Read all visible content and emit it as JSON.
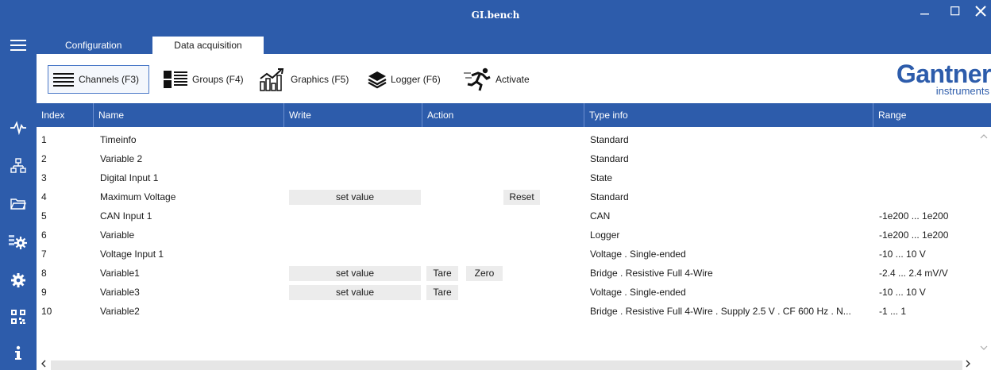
{
  "window": {
    "title": "GI.bench"
  },
  "tabs": [
    {
      "label": "Configuration"
    },
    {
      "label": "Data acquisition"
    }
  ],
  "toolbar": {
    "channels": "Channels (F3)",
    "groups": "Groups (F4)",
    "graphics": "Graphics (F5)",
    "logger": "Logger (F6)",
    "activate": "Activate"
  },
  "logo": {
    "brand": "Gantner",
    "sub": "instruments"
  },
  "table": {
    "headers": [
      "Index",
      "Name",
      "Write",
      "Action",
      "Type info",
      "Range"
    ],
    "rows": [
      {
        "index": "1",
        "name": "Timeinfo",
        "write": "",
        "tare": "",
        "zero": "",
        "reset": "",
        "type": "Standard",
        "range": ""
      },
      {
        "index": "2",
        "name": "Variable 2",
        "write": "",
        "tare": "",
        "zero": "",
        "reset": "",
        "type": "Standard",
        "range": ""
      },
      {
        "index": "3",
        "name": "Digital Input 1",
        "write": "",
        "tare": "",
        "zero": "",
        "reset": "",
        "type": "State",
        "range": ""
      },
      {
        "index": "4",
        "name": "Maximum Voltage",
        "write": "set value",
        "tare": "",
        "zero": "",
        "reset": "Reset",
        "type": "Standard",
        "range": ""
      },
      {
        "index": "5",
        "name": "CAN Input 1",
        "write": "",
        "tare": "",
        "zero": "",
        "reset": "",
        "type": "CAN",
        "range": "-1e200 ... 1e200"
      },
      {
        "index": "6",
        "name": "Variable",
        "write": "",
        "tare": "",
        "zero": "",
        "reset": "",
        "type": "Logger",
        "range": "-1e200 ... 1e200"
      },
      {
        "index": "7",
        "name": "Voltage Input 1",
        "write": "",
        "tare": "",
        "zero": "",
        "reset": "",
        "type": "Voltage . Single-ended",
        "range": "-10 ... 10 V"
      },
      {
        "index": "8",
        "name": "Variable1",
        "write": "set value",
        "tare": "Tare",
        "zero": "Zero",
        "reset": "",
        "type": "Bridge . Resistive Full 4-Wire",
        "range": "-2.4 ... 2.4 mV/V"
      },
      {
        "index": "9",
        "name": "Variable3",
        "write": "set value",
        "tare": "Tare",
        "zero": "",
        "reset": "",
        "type": "Voltage . Single-ended",
        "range": "-10 ... 10 V"
      },
      {
        "index": "10",
        "name": "Variable2",
        "write": "",
        "tare": "",
        "zero": "",
        "reset": "",
        "type": "Bridge . Resistive Full 4-Wire . Supply 2.5 V . CF 600 Hz . N...",
        "range": "-1 ... 1"
      }
    ]
  },
  "icons": {
    "menu": "hamburger-icon",
    "signal": "signal-icon",
    "network": "network-icon",
    "folder": "folder-icon",
    "device_settings": "device-settings-icon",
    "settings": "gear-icon",
    "qr": "qr-code-icon",
    "info": "info-icon"
  },
  "colors": {
    "accent": "#2d5cab",
    "button_bg": "#ececec"
  }
}
